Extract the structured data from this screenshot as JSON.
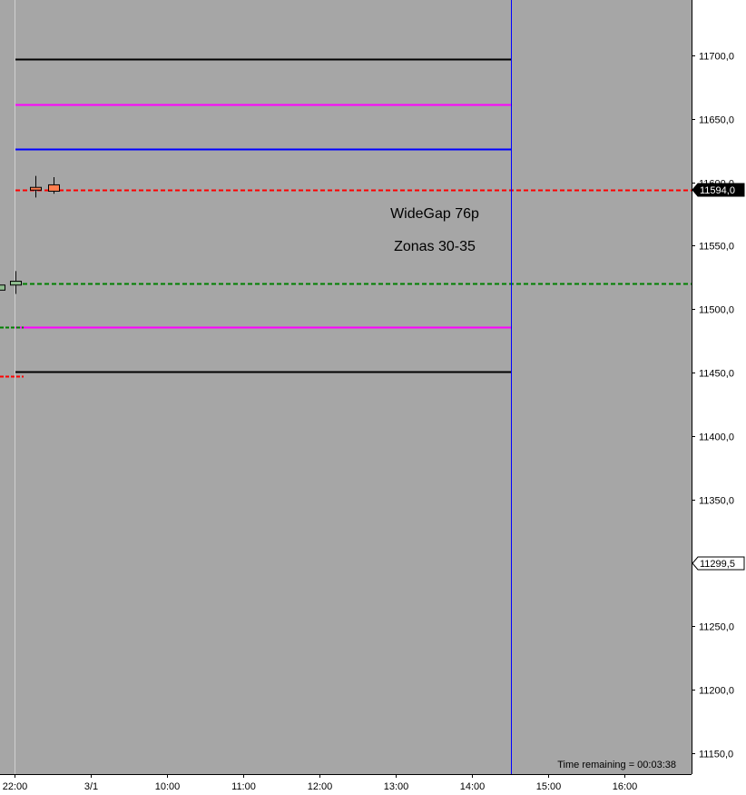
{
  "chart_data": {
    "type": "candlestick",
    "colors": {
      "background": "#a6a6a6",
      "axis_background": "#ffffff",
      "vertical_session_line": "#0000ff",
      "day_separator": "#d0d0d0",
      "up_candle": "#8fbc8f",
      "down_candle": "#ff7f50"
    },
    "y_axis": {
      "range": [
        11130,
        11760
      ],
      "ticks": [
        {
          "value": 11700,
          "label": "11700,0"
        },
        {
          "value": 11650,
          "label": "11650,0"
        },
        {
          "value": 11600,
          "label": "11600,0"
        },
        {
          "value": 11550,
          "label": "11550,0"
        },
        {
          "value": 11500,
          "label": "11500,0"
        },
        {
          "value": 11450,
          "label": "11450,0"
        },
        {
          "value": 11400,
          "label": "11400,0"
        },
        {
          "value": 11350,
          "label": "11350,0"
        },
        {
          "value": 11300,
          "label": "11300,0"
        },
        {
          "value": 11250,
          "label": "11250,0"
        },
        {
          "value": 11200,
          "label": "11200,0"
        },
        {
          "value": 11150,
          "label": "11150,0"
        }
      ]
    },
    "x_axis": {
      "ticks": [
        "22:00",
        "3/1",
        "10:00",
        "11:00",
        "12:00",
        "13:00",
        "14:00",
        "15:00",
        "16:00"
      ]
    },
    "horizontal_levels": [
      {
        "value": 11697,
        "color": "#000000",
        "style": "solid",
        "span": "session"
      },
      {
        "value": 11661,
        "color": "#ff00ff",
        "style": "solid",
        "span": "session"
      },
      {
        "value": 11626,
        "color": "#0000ff",
        "style": "solid",
        "span": "session"
      },
      {
        "value": 11594,
        "color": "#ff0000",
        "style": "dashed",
        "span": "full"
      },
      {
        "value": 11520,
        "color": "#008000",
        "style": "dashed",
        "span": "full"
      },
      {
        "value": 11486,
        "color": "#ff00ff",
        "style": "solid",
        "span": "session"
      },
      {
        "value": 11451,
        "color": "#000000",
        "style": "solid",
        "span": "session"
      }
    ],
    "prior_levels": [
      {
        "value": 11486,
        "color": "#008000"
      },
      {
        "value": 11447,
        "color": "#ff0000"
      }
    ],
    "candles": [
      {
        "x": "prev",
        "open": 11515,
        "close": 11519,
        "high": 11521,
        "low": 11513
      },
      {
        "x": "22:00",
        "open": 11519,
        "close": 11522,
        "high": 11530,
        "low": 11512
      },
      {
        "x": "22:15",
        "open": 11596,
        "close": 11594,
        "high": 11605,
        "low": 11588
      },
      {
        "x": "22:30",
        "open": 11598,
        "close": 11593,
        "high": 11604,
        "low": 11591
      }
    ],
    "price_labels": [
      {
        "value": 11594,
        "label": "11594,0",
        "highlight": true
      },
      {
        "value": 11299.5,
        "label": "11299,5",
        "highlight": false
      }
    ],
    "annotations": [
      "WideGap 76p",
      "Zonas 30-35"
    ],
    "status_text": "Time remaining = 00:03:38"
  }
}
